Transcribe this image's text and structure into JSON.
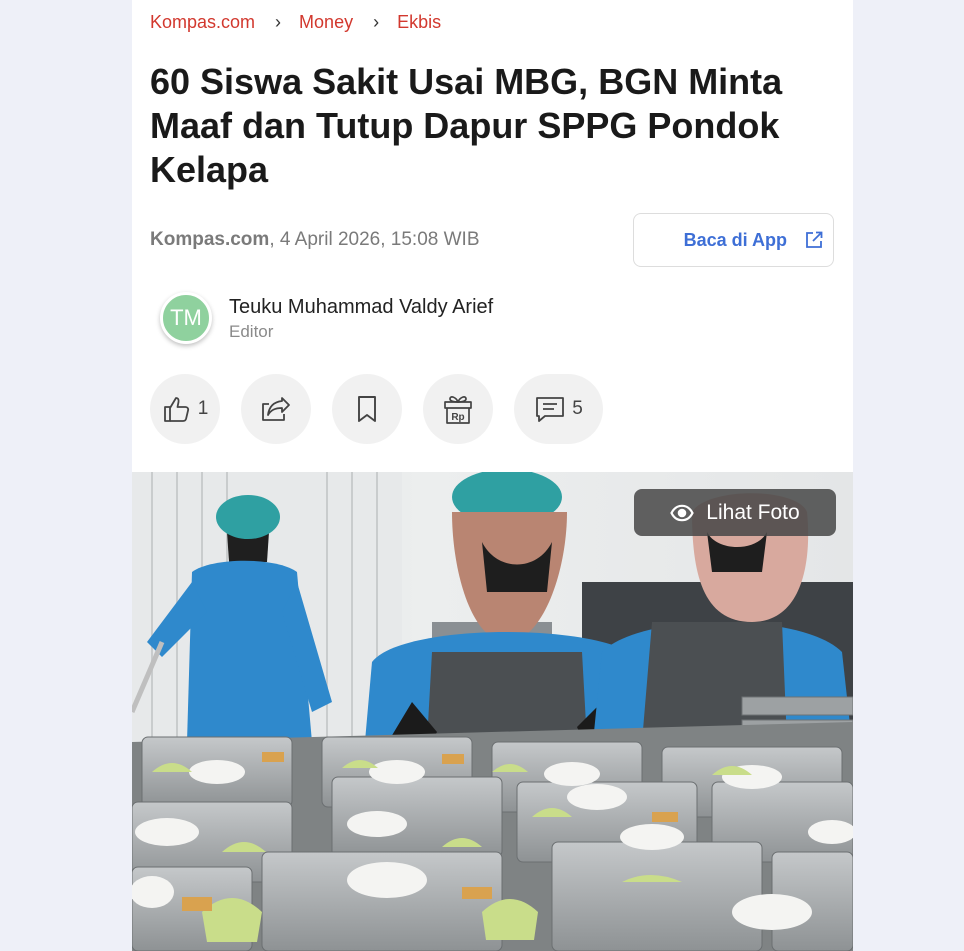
{
  "breadcrumb": {
    "items": [
      "Kompas.com",
      "Money",
      "Ekbis"
    ],
    "separator": "›"
  },
  "article": {
    "title": "60 Siswa Sakit Usai MBG, BGN Minta Maaf dan Tutup Dapur SPPG Pondok Kelapa",
    "source": "Kompas.com",
    "date": ", 4 April 2026, 15:08 WIB"
  },
  "app_button": {
    "label": "Baca di App",
    "icon": "external-link-icon"
  },
  "author": {
    "initials": "TM",
    "name": "Teuku Muhammad Valdy Arief",
    "role": "Editor",
    "avatar_color": "#8fd19e"
  },
  "actions": {
    "like": {
      "icon": "thumbs-up-icon",
      "count": "1"
    },
    "share": {
      "icon": "share-icon"
    },
    "bookmark": {
      "icon": "bookmark-icon"
    },
    "gift": {
      "icon": "gift-rp-icon",
      "label": "Rp"
    },
    "comment": {
      "icon": "comment-icon",
      "count": "5"
    }
  },
  "photo": {
    "button_label": "Lihat Foto",
    "button_icon": "eye-icon"
  },
  "colors": {
    "accent_red": "#d2382e",
    "link_blue": "#3e6fd6",
    "page_bg": "#eef0f8"
  }
}
